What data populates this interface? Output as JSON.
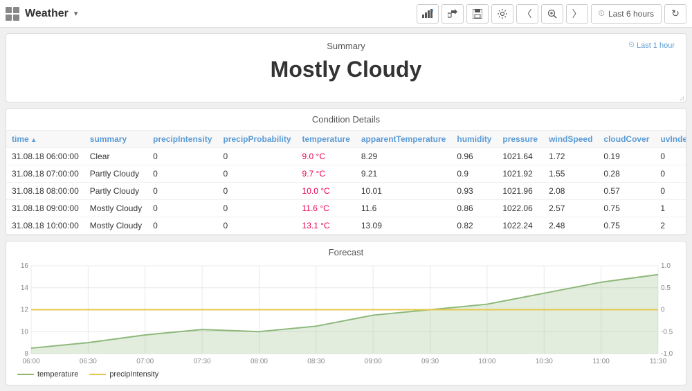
{
  "header": {
    "title": "Weather",
    "dropdown_arrow": "▾",
    "buttons": [
      "chart-add",
      "share",
      "save",
      "settings",
      "prev",
      "zoom",
      "next",
      "last6hours",
      "refresh"
    ],
    "last6hours_label": "Last 6 hours"
  },
  "summary": {
    "title": "Summary",
    "time_label": "Last 1 hour",
    "value": "Mostly Cloudy"
  },
  "condition_details": {
    "title": "Condition Details",
    "columns": [
      "time",
      "summary",
      "precipIntensity",
      "precipProbability",
      "temperature",
      "apparentTemperature",
      "humidity",
      "pressure",
      "windSpeed",
      "cloudCover",
      "uvIndex"
    ],
    "rows": [
      [
        "31.08.18 06:00:00",
        "Clear",
        "0",
        "0",
        "9.0 °C",
        "8.29",
        "0.96",
        "1021.64",
        "1.72",
        "0.19",
        "0"
      ],
      [
        "31.08.18 07:00:00",
        "Partly Cloudy",
        "0",
        "0",
        "9.7 °C",
        "9.21",
        "0.9",
        "1021.92",
        "1.55",
        "0.28",
        "0"
      ],
      [
        "31.08.18 08:00:00",
        "Partly Cloudy",
        "0",
        "0",
        "10.0 °C",
        "10.01",
        "0.93",
        "1021.96",
        "2.08",
        "0.57",
        "0"
      ],
      [
        "31.08.18 09:00:00",
        "Mostly Cloudy",
        "0",
        "0",
        "11.6 °C",
        "11.6",
        "0.86",
        "1022.06",
        "2.57",
        "0.75",
        "1"
      ],
      [
        "31.08.18 10:00:00",
        "Mostly Cloudy",
        "0",
        "0",
        "13.1 °C",
        "13.09",
        "0.82",
        "1022.24",
        "2.48",
        "0.75",
        "2"
      ]
    ]
  },
  "forecast": {
    "title": "Forecast",
    "x_labels": [
      "06:00",
      "06:30",
      "07:00",
      "07:30",
      "08:00",
      "08:30",
      "09:00",
      "09:30",
      "10:00",
      "10:30",
      "11:00",
      "11:30"
    ],
    "y_left_labels": [
      "8",
      "10",
      "12",
      "14",
      "16"
    ],
    "y_right_labels": [
      "-1.0",
      "-0.5",
      "0",
      "0.5",
      "1.0"
    ],
    "legend": [
      {
        "label": "temperature",
        "color": "#8db87a"
      },
      {
        "label": "precipIntensity",
        "color": "#e6c84a"
      }
    ],
    "temperature_points": [
      {
        "x": 0,
        "y": 8.5
      },
      {
        "x": 1,
        "y": 9.0
      },
      {
        "x": 2,
        "y": 9.7
      },
      {
        "x": 3,
        "y": 10.2
      },
      {
        "x": 4,
        "y": 10.0
      },
      {
        "x": 5,
        "y": 10.5
      },
      {
        "x": 6,
        "y": 11.5
      },
      {
        "x": 7,
        "y": 12.0
      },
      {
        "x": 8,
        "y": 12.5
      },
      {
        "x": 9,
        "y": 13.5
      },
      {
        "x": 10,
        "y": 14.5
      },
      {
        "x": 11,
        "y": 15.2
      }
    ],
    "precip_points": [
      {
        "x": 0,
        "y": 12.0
      },
      {
        "x": 11,
        "y": 12.0
      }
    ]
  }
}
